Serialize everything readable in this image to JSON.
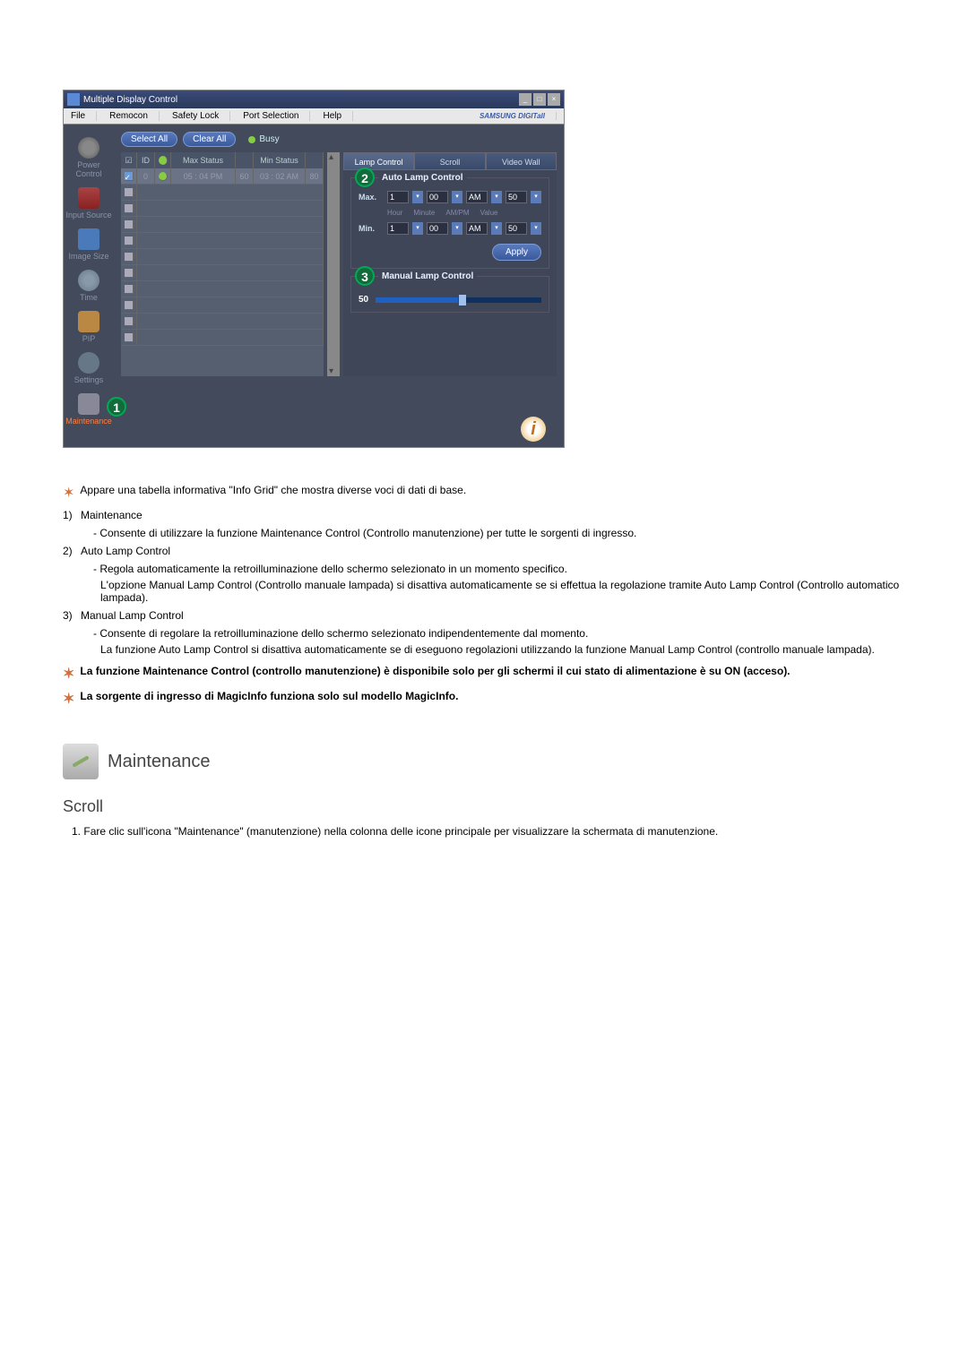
{
  "app": {
    "title": "Multiple Display Control",
    "menu": [
      "File",
      "Remocon",
      "Safety Lock",
      "Port Selection",
      "Help"
    ],
    "brand": "SAMSUNG DIGITall"
  },
  "sidebar": {
    "items": [
      {
        "label": "Power Control"
      },
      {
        "label": "Input Source"
      },
      {
        "label": "Image Size"
      },
      {
        "label": "Time"
      },
      {
        "label": "PIP"
      },
      {
        "label": "Settings"
      },
      {
        "label": "Maintenance"
      }
    ],
    "badge1": "1"
  },
  "buttons": {
    "selectAll": "Select All",
    "clearAll": "Clear All",
    "busy": "Busy",
    "apply": "Apply"
  },
  "grid": {
    "headers": {
      "chk": "☑",
      "id": "ID",
      "status": "⬤",
      "max": "Max Status",
      "v1": "",
      "min": "Min Status",
      "v2": ""
    },
    "row1": {
      "id": "0",
      "max": "05 : 04 PM",
      "v1": "60",
      "min": "03 : 02 AM",
      "v2": "80"
    }
  },
  "tabs": {
    "t1": "Lamp Control",
    "t2": "Scroll",
    "t3": "Video Wall"
  },
  "autoLamp": {
    "title": "Auto Lamp Control",
    "badge": "2",
    "max": "Max.",
    "min": "Min.",
    "hour1": "1",
    "min1": "00",
    "ampm1": "AM",
    "val1": "50",
    "hour2": "1",
    "min2": "00",
    "ampm2": "AM",
    "val2": "50",
    "labels": {
      "hour": "Hour",
      "minute": "Minute",
      "ampm": "AM/PM",
      "value": "Value"
    }
  },
  "manualLamp": {
    "title": "Manual Lamp Control",
    "badge": "3",
    "value": "50"
  },
  "doc": {
    "intro": "Appare una tabella informativa \"Info Grid\" che mostra diverse voci di dati di base.",
    "item1": {
      "num": "1)",
      "title": "Maintenance",
      "desc": "- Consente di utilizzare la funzione Maintenance Control (Controllo manutenzione) per tutte le sorgenti di ingresso."
    },
    "item2": {
      "num": "2)",
      "title": "Auto Lamp Control",
      "desc1": "- Regola automaticamente la retroilluminazione dello schermo selezionato in un momento specifico.",
      "desc2": "L'opzione Manual Lamp Control (Controllo manuale lampada) si disattiva automaticamente se si effettua la regolazione tramite Auto Lamp Control (Controllo automatico lampada)."
    },
    "item3": {
      "num": "3)",
      "title": "Manual Lamp Control",
      "desc1": "- Consente di regolare la retroilluminazione dello schermo selezionato indipendentemente dal momento.",
      "desc2": "La funzione Auto Lamp Control si disattiva automaticamente se di eseguono regolazioni utilizzando la funzione Manual Lamp Control (controllo manuale lampada)."
    },
    "note1": "La funzione Maintenance Control (controllo manutenzione) è disponibile solo per gli schermi il cui stato di alimentazione è su ON (acceso).",
    "note2": "La sorgente di ingresso di MagicInfo funziona solo sul modello MagicInfo.",
    "sectionTitle": "Maintenance",
    "subsection": "Scroll",
    "ol1num": "1.",
    "ol1": "Fare clic sull'icona \"Maintenance\" (manutenzione) nella colonna delle icone principale per visualizzare la schermata di manutenzione."
  }
}
